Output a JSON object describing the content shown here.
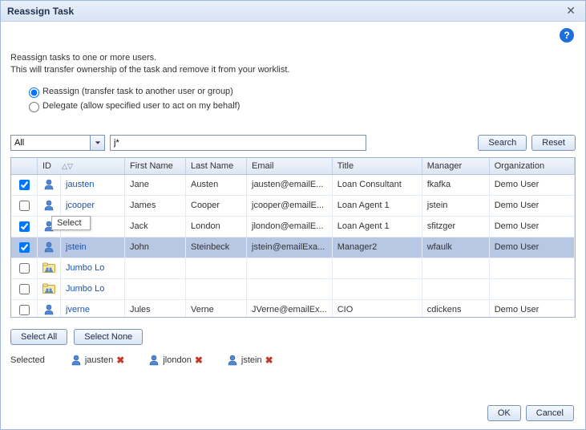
{
  "dialog": {
    "title": "Reassign Task"
  },
  "intro": {
    "line1": "Reassign tasks to one or more users.",
    "line2": "This will transfer ownership of the task and remove it from your worklist."
  },
  "options": {
    "reassign_label": "Reassign (transfer task to another user or group)",
    "delegate_label": "Delegate (allow specified user to act on my behalf)",
    "selected": "reassign"
  },
  "search": {
    "scope_value": "All",
    "query": "j*",
    "search_btn": "Search",
    "reset_btn": "Reset"
  },
  "table": {
    "headers": {
      "id": "ID",
      "first_name": "First Name",
      "last_name": "Last Name",
      "email": "Email",
      "title": "Title",
      "manager": "Manager",
      "organization": "Organization"
    },
    "rows": [
      {
        "checked": true,
        "type": "user",
        "id": "jausten",
        "first_name": "Jane",
        "last_name": "Austen",
        "email": "jausten@emailE...",
        "title": "Loan Consultant",
        "manager": "fkafka",
        "organization": "Demo User",
        "selected": false
      },
      {
        "checked": false,
        "type": "user",
        "id": "jcooper",
        "first_name": "James",
        "last_name": "Cooper",
        "email": "jcooper@emailE...",
        "title": "Loan Agent 1",
        "manager": "jstein",
        "organization": "Demo User",
        "selected": false
      },
      {
        "checked": true,
        "type": "user",
        "id": "",
        "first_name": "Jack",
        "last_name": "London",
        "email": "jlondon@emailE...",
        "title": "Loan Agent 1",
        "manager": "sfitzger",
        "organization": "Demo User",
        "selected": false
      },
      {
        "checked": true,
        "type": "user",
        "id": "jstein",
        "first_name": "John",
        "last_name": "Steinbeck",
        "email": "jstein@emailExa...",
        "title": "Manager2",
        "manager": "wfaulk",
        "organization": "Demo User",
        "selected": true
      },
      {
        "checked": false,
        "type": "group",
        "id": "Jumbo Lo",
        "first_name": "",
        "last_name": "",
        "email": "",
        "title": "",
        "manager": "",
        "organization": "",
        "selected": false
      },
      {
        "checked": false,
        "type": "group",
        "id": "Jumbo Lo",
        "first_name": "",
        "last_name": "",
        "email": "",
        "title": "",
        "manager": "",
        "organization": "",
        "selected": false
      },
      {
        "checked": false,
        "type": "user",
        "id": "jverne",
        "first_name": "Jules",
        "last_name": "Verne",
        "email": "JVerne@emailEx...",
        "title": "CIO",
        "manager": "cdickens",
        "organization": "Demo User",
        "selected": false
      }
    ],
    "tooltip": "Select"
  },
  "selection": {
    "select_all": "Select All",
    "select_none": "Select None",
    "label": "Selected",
    "items": [
      {
        "id": "jausten"
      },
      {
        "id": "jlondon"
      },
      {
        "id": "jstein"
      }
    ]
  },
  "footer": {
    "ok": "OK",
    "cancel": "Cancel"
  }
}
